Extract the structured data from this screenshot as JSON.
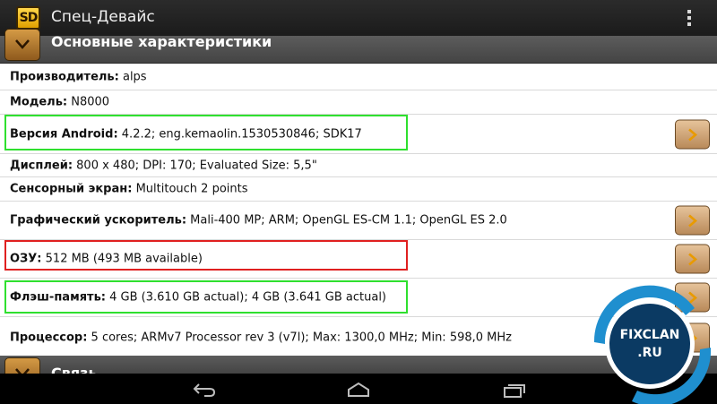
{
  "app": {
    "logo": "SD",
    "title": "Спец-Девайс",
    "menu_icon": "overflow-menu-icon"
  },
  "sections": {
    "main": "Основные характеристики",
    "connection": "Связь"
  },
  "rows": [
    {
      "label": "Производитель:",
      "value": " alps",
      "has_arrow": false,
      "highlight": ""
    },
    {
      "label": "Модель:",
      "value": " N8000",
      "has_arrow": false,
      "highlight": ""
    },
    {
      "label": "Версия Android:",
      "value": " 4.2.2; eng.kemaolin.1530530846; SDK17",
      "has_arrow": true,
      "highlight": "green"
    },
    {
      "label": "Дисплей:",
      "value": " 800 x 480; DPI: 170; Evaluated Size: 5,5\"",
      "has_arrow": false,
      "highlight": ""
    },
    {
      "label": "Сенсорный экран:",
      "value": " Multitouch 2 points",
      "has_arrow": false,
      "highlight": ""
    },
    {
      "label": "Графический ускоритель:",
      "value": " Mali-400 MP; ARM; OpenGL ES-CM 1.1; OpenGL ES 2.0",
      "has_arrow": true,
      "highlight": ""
    },
    {
      "label": "ОЗУ:",
      "value": " 512 MB (493 MB available)",
      "has_arrow": true,
      "highlight": "red"
    },
    {
      "label": "Флэш-память:",
      "value": " 4 GB (3.610 GB actual); 4 GB (3.641 GB actual)",
      "has_arrow": true,
      "highlight": "green"
    },
    {
      "label": "Процессор:",
      "value": " 5 cores; ARMv7 Processor rev 3 (v7l); Max: 1300,0 MHz; Min: 598,0 MHz",
      "has_arrow": true,
      "highlight": ""
    }
  ],
  "nav": {
    "back_icon": "back-icon",
    "home_icon": "home-icon",
    "recents_icon": "recent-apps-icon"
  },
  "watermark": {
    "line1": "FIXCLAN",
    "line2": ".RU"
  },
  "colors": {
    "accent_button": "#d49a45",
    "highlight_green": "#2fe02f",
    "highlight_red": "#e02020",
    "header_bar": "#4f4f4f"
  }
}
